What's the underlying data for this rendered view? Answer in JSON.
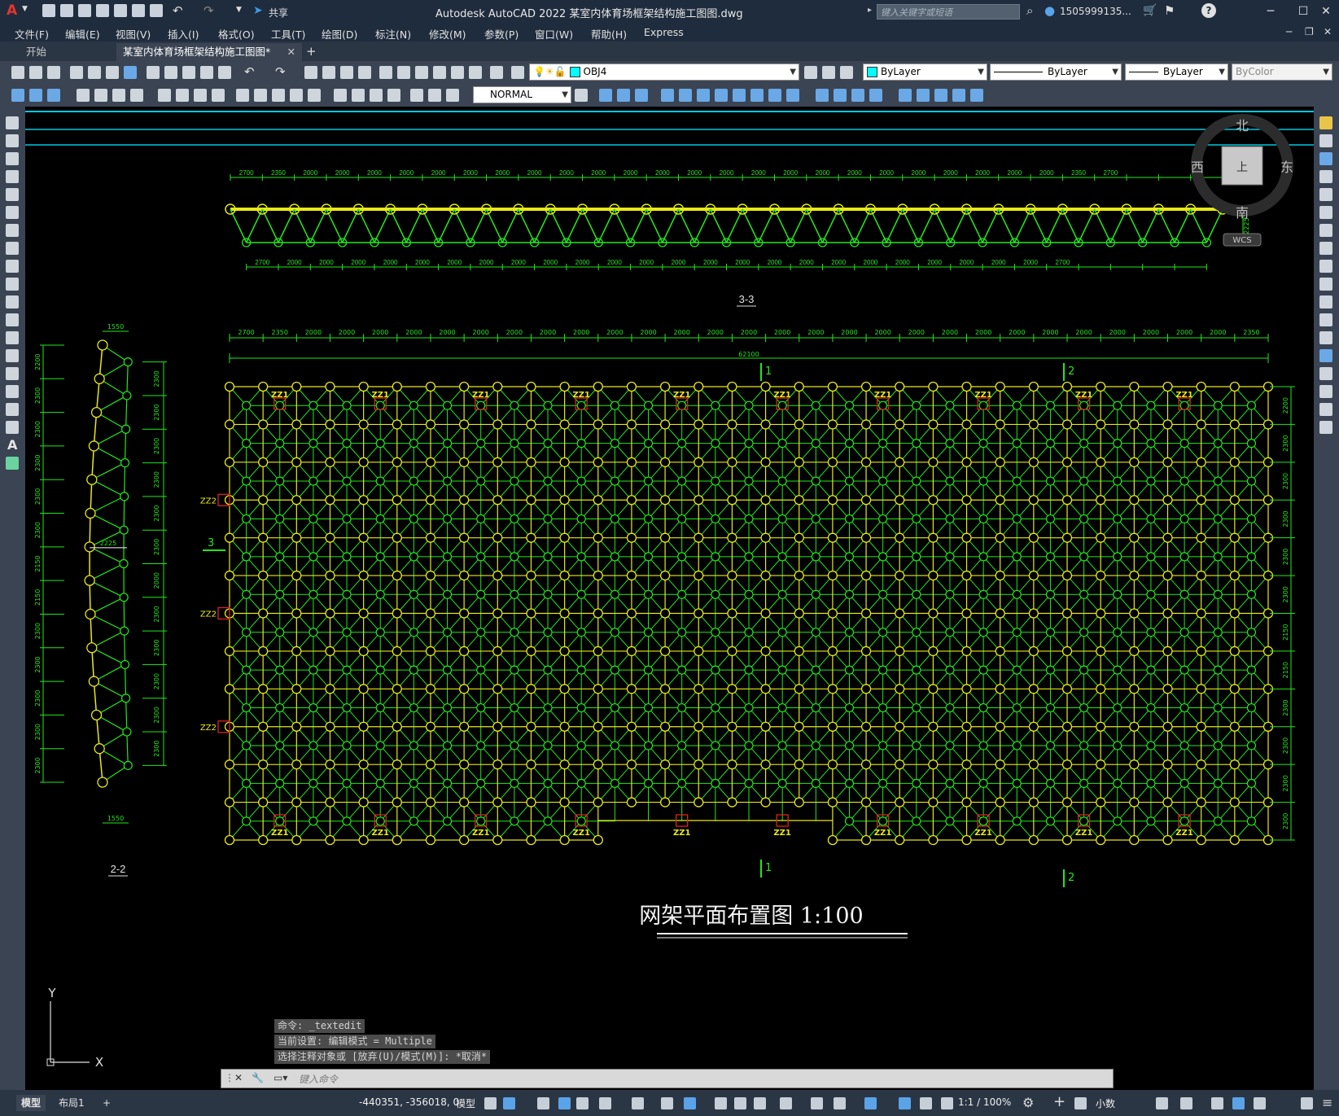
{
  "app": {
    "title": "Autodesk AutoCAD 2022    某室内体育场框架结构施工图图.dwg",
    "search_placeholder": "键入关键字或短语",
    "user": "1505999135...",
    "share": "共享",
    "logo": "A"
  },
  "menu": [
    "文件(F)",
    "编辑(E)",
    "视图(V)",
    "插入(I)",
    "格式(O)",
    "工具(T)",
    "绘图(D)",
    "标注(N)",
    "修改(M)",
    "参数(P)",
    "窗口(W)",
    "帮助(H)",
    "Express"
  ],
  "tabs": {
    "start": "开始",
    "active": "某室内体育场框架结构施工图图*",
    "add": "+"
  },
  "toolbar": {
    "layer": "OBJ4",
    "color": "ByLayer",
    "linetype": "ByLayer",
    "lineweight": "ByLayer",
    "plotstyle": "ByColor",
    "dimstyle": "NORMAL"
  },
  "viewcube": {
    "north": "北",
    "south": "南",
    "east": "东",
    "west": "西",
    "face": "上",
    "wcs": "WCS"
  },
  "drawing": {
    "title": "网架平面布置图   1:100",
    "section_33": "3-3",
    "section_22": "2-2",
    "cut_1": "1",
    "cut_2": "2",
    "cut_3": "3",
    "zz1": "ZZ1",
    "zz2": "ZZ2",
    "dim_top_33": [
      "2700",
      "2350",
      "2000",
      "2000",
      "2000",
      "2000",
      "2000",
      "2000",
      "2000",
      "2000",
      "2000",
      "2000",
      "2000",
      "2000",
      "2000",
      "2000",
      "2000",
      "2000",
      "2000",
      "2000",
      "2000",
      "2000",
      "2000",
      "2000",
      "2000",
      "2000",
      "2350",
      "2700"
    ],
    "dim_bot_33": [
      "2700",
      "2000",
      "2000",
      "2000",
      "2000",
      "2000",
      "2000",
      "2000",
      "2000",
      "2000",
      "2000",
      "2000",
      "2000",
      "2000",
      "2000",
      "2000",
      "2000",
      "2000",
      "2000",
      "2000",
      "2000",
      "2000",
      "2000",
      "2000",
      "2000",
      "2700"
    ],
    "dim_33_side": "2225",
    "dim_plan": [
      "2700",
      "2350",
      "2000",
      "2000",
      "2000",
      "2000",
      "2000",
      "2000",
      "2000",
      "2000",
      "2000",
      "2000",
      "2000",
      "2000",
      "2000",
      "2000",
      "2000",
      "2000",
      "2000",
      "2000",
      "2000",
      "2000",
      "2000",
      "2000",
      "2000",
      "2000",
      "2000",
      "2000",
      "2000",
      "2000",
      "2350",
      "2700"
    ],
    "dim_plan_total": "62100",
    "dim_plan_right": [
      "2200",
      "2300",
      "2300",
      "2300",
      "2300",
      "2300",
      "2150",
      "2150",
      "2300",
      "2300",
      "2300",
      "2300",
      "2300",
      "2200"
    ],
    "dim_22_left": [
      "2200",
      "2300",
      "2300",
      "2300",
      "2300",
      "2300",
      "2150",
      "2150",
      "2300",
      "2300",
      "2300",
      "2300",
      "2300",
      "2200"
    ],
    "dim_22_right": [
      "2300",
      "2300",
      "2300",
      "2300",
      "2300",
      "2300",
      "2000",
      "2300",
      "2300",
      "2300",
      "2300",
      "2300",
      "2300"
    ],
    "dim_22_topbot": "1550",
    "dim_22_mid": "2225"
  },
  "command": {
    "lines": [
      "命令: _textedit",
      "当前设置: 编辑模式 = Multiple",
      "选择注释对象或 [放弃(U)/模式(M)]: *取消*"
    ],
    "placeholder": "键入命令"
  },
  "status": {
    "tab_model": "模型",
    "tab_layout": "布局1",
    "tab_add": "+",
    "coords": "-440351, -356018, 0",
    "space": "模型",
    "scale": "1:1 / 100%",
    "units": "小数"
  }
}
